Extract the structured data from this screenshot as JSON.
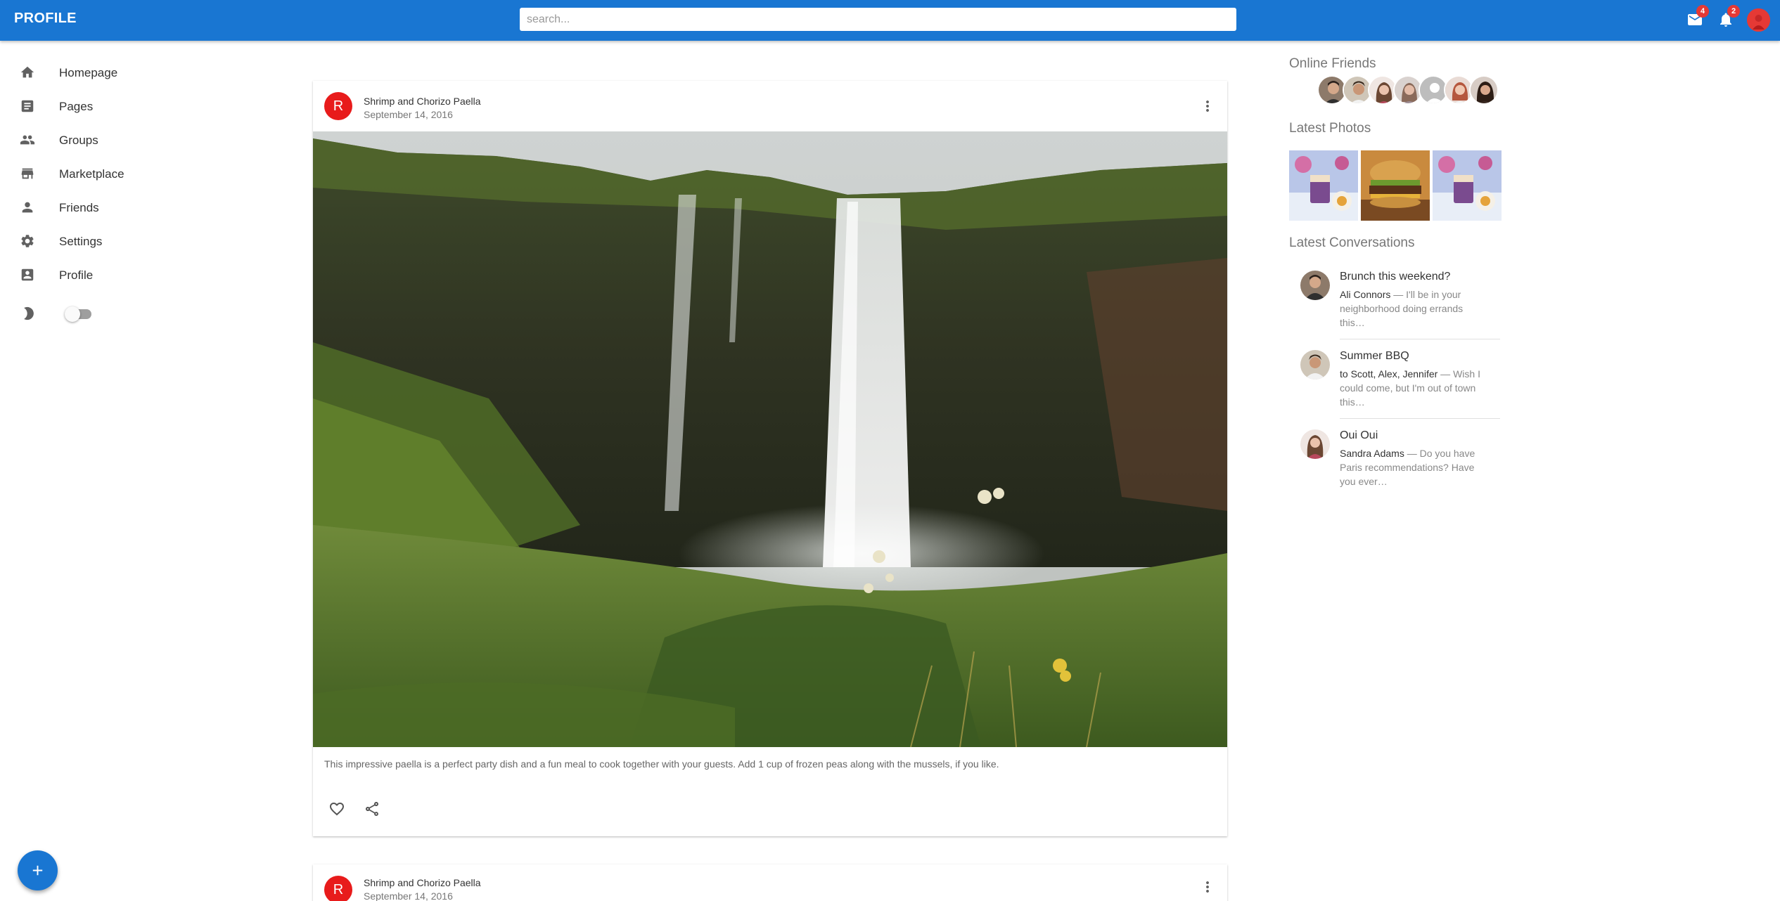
{
  "app": {
    "brand": "PROFILE"
  },
  "search": {
    "placeholder": "search..."
  },
  "header": {
    "mail_badge": "4",
    "notifications_badge": "2"
  },
  "sidebar": {
    "items": [
      {
        "label": "Homepage",
        "icon": "home-icon"
      },
      {
        "label": "Pages",
        "icon": "article-icon"
      },
      {
        "label": "Groups",
        "icon": "people-icon"
      },
      {
        "label": "Marketplace",
        "icon": "storefront-icon"
      },
      {
        "label": "Friends",
        "icon": "person-icon"
      },
      {
        "label": "Settings",
        "icon": "gear-icon"
      },
      {
        "label": "Profile",
        "icon": "account-box-icon"
      }
    ],
    "dark_mode": {
      "icon": "moon-icon",
      "enabled": false
    }
  },
  "posts": [
    {
      "avatar_letter": "R",
      "title": "Shrimp and Chorizo Paella",
      "date": "September 14, 2016",
      "text": "This impressive paella is a perfect party dish and a fun meal to cook together with your guests. Add 1 cup of frozen peas along with the mussels, if you like."
    },
    {
      "avatar_letter": "R",
      "title": "Shrimp and Chorizo Paella",
      "date": "September 14, 2016"
    }
  ],
  "right": {
    "online_friends_title": "Online Friends",
    "latest_photos_title": "Latest Photos",
    "latest_conversations_title": "Latest Conversations",
    "conversations": [
      {
        "title": "Brunch this weekend?",
        "who": "Ali Connors",
        "snippet": " — I'll be in your neighborhood doing errands this…"
      },
      {
        "title": "Summer BBQ",
        "who": "to Scott, Alex, Jennifer",
        "snippet": " — Wish I could come, but I'm out of town this…"
      },
      {
        "title": "Oui Oui",
        "who": "Sandra Adams",
        "snippet": " — Do you have Paris recommendations? Have you ever…"
      }
    ]
  },
  "colors": {
    "primary": "#1976d2",
    "badge": "#e53935",
    "post_avatar": "#e81b1b"
  }
}
